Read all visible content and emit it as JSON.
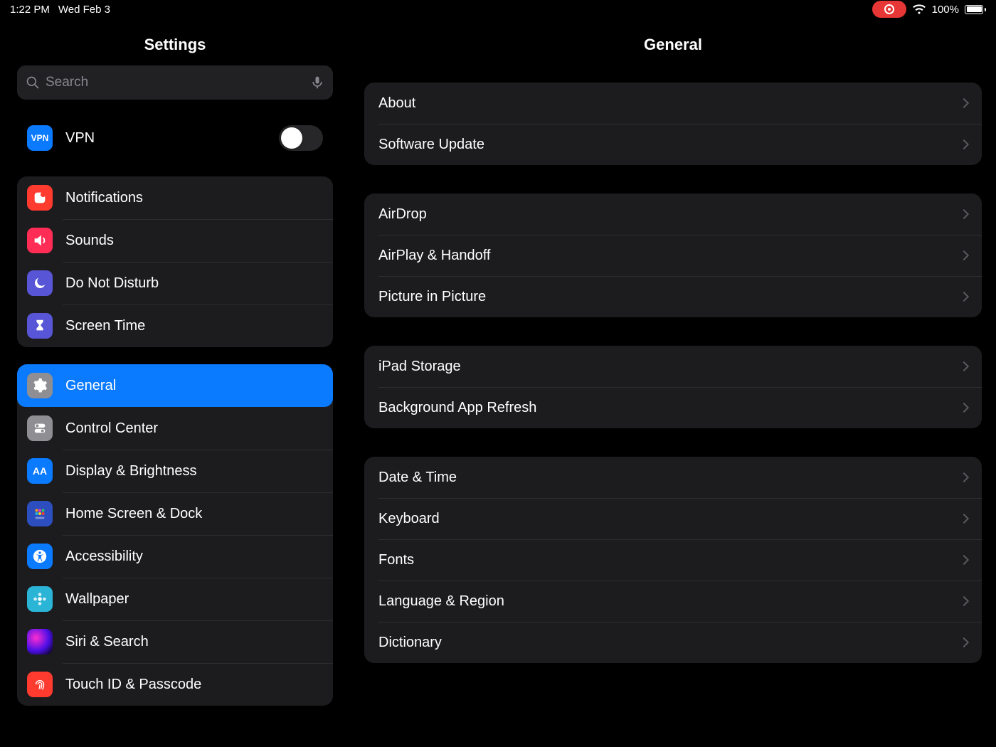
{
  "status": {
    "time": "1:22 PM",
    "date": "Wed Feb 3",
    "battery_pct": "100%"
  },
  "sidebar": {
    "title": "Settings",
    "search_placeholder": "Search",
    "vpn_label": "VPN",
    "group_vpn": {
      "vpn": "VPN"
    },
    "group_alerts": {
      "notifications": "Notifications",
      "sounds": "Sounds",
      "dnd": "Do Not Disturb",
      "screentime": "Screen Time"
    },
    "group_device": {
      "general": "General",
      "control": "Control Center",
      "display": "Display & Brightness",
      "home": "Home Screen & Dock",
      "acc": "Accessibility",
      "wallpaper": "Wallpaper",
      "siri": "Siri & Search",
      "touchid": "Touch ID & Passcode"
    }
  },
  "detail": {
    "title": "General",
    "g1": {
      "about": "About",
      "software": "Software Update"
    },
    "g2": {
      "airdrop": "AirDrop",
      "airplay": "AirPlay & Handoff",
      "pip": "Picture in Picture"
    },
    "g3": {
      "storage": "iPad Storage",
      "bgrefresh": "Background App Refresh"
    },
    "g4": {
      "datetime": "Date & Time",
      "keyboard": "Keyboard",
      "fonts": "Fonts",
      "lang": "Language & Region",
      "dict": "Dictionary"
    }
  }
}
